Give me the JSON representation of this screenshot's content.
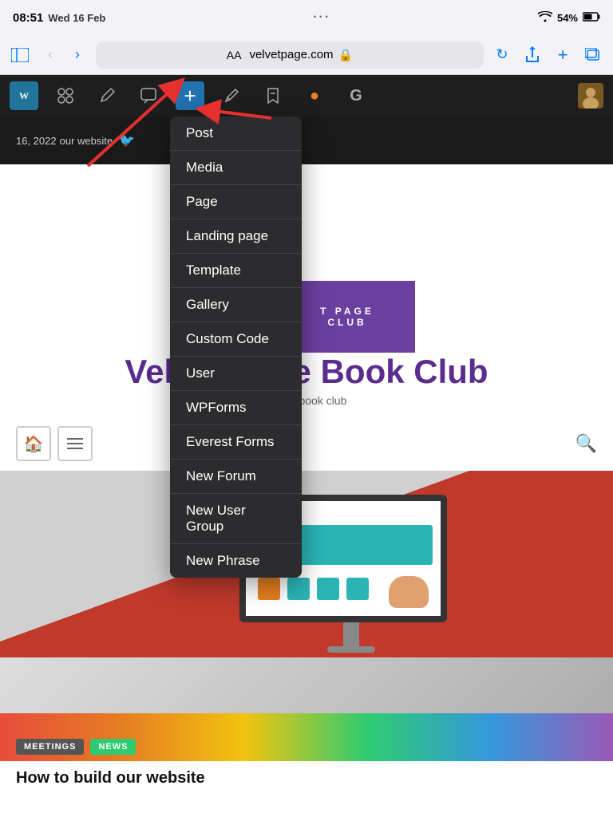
{
  "statusBar": {
    "time": "08:51",
    "date": "Wed 16 Feb",
    "wifi": "WiFi",
    "battery": "54%"
  },
  "browser": {
    "addressAA": "AA",
    "url": "velvetpage.com",
    "lockIcon": "🔒",
    "refreshIcon": "↺",
    "shareIcon": "↑",
    "addTabIcon": "+",
    "tabsIcon": "⊞",
    "sidebarIcon": "⊟",
    "backIcon": "‹",
    "forwardIcon": "›",
    "dotsLabel": "···"
  },
  "toolbar": {
    "wpLabel": "W",
    "paintLabel": "🎨",
    "penLabel": "/",
    "commentLabel": "💬",
    "plusLabel": "+",
    "pencilLabel": "✏",
    "bookmarkLabel": "◈",
    "dotLabel": "●",
    "googleLabel": "G"
  },
  "dropdown": {
    "items": [
      {
        "label": "Post"
      },
      {
        "label": "Media"
      },
      {
        "label": "Page"
      },
      {
        "label": "Landing page"
      },
      {
        "label": "Template"
      },
      {
        "label": "Gallery"
      },
      {
        "label": "Custom Code"
      },
      {
        "label": "User"
      },
      {
        "label": "WPForms"
      },
      {
        "label": "Everest Forms"
      },
      {
        "label": "New Forum"
      },
      {
        "label": "New User Group"
      },
      {
        "label": "New Phrase"
      }
    ]
  },
  "website": {
    "headerText": "16, 2022",
    "headerSub": "our website",
    "bannerLine1": "T PAGE",
    "bannerLine2": "CLUB",
    "pageTitle": "Velvet Page Book Club",
    "subtitle": "BTQ+ book club",
    "postTitle": "How to build our website",
    "badge1": "MEETINGS",
    "badge2": "NEWS"
  }
}
